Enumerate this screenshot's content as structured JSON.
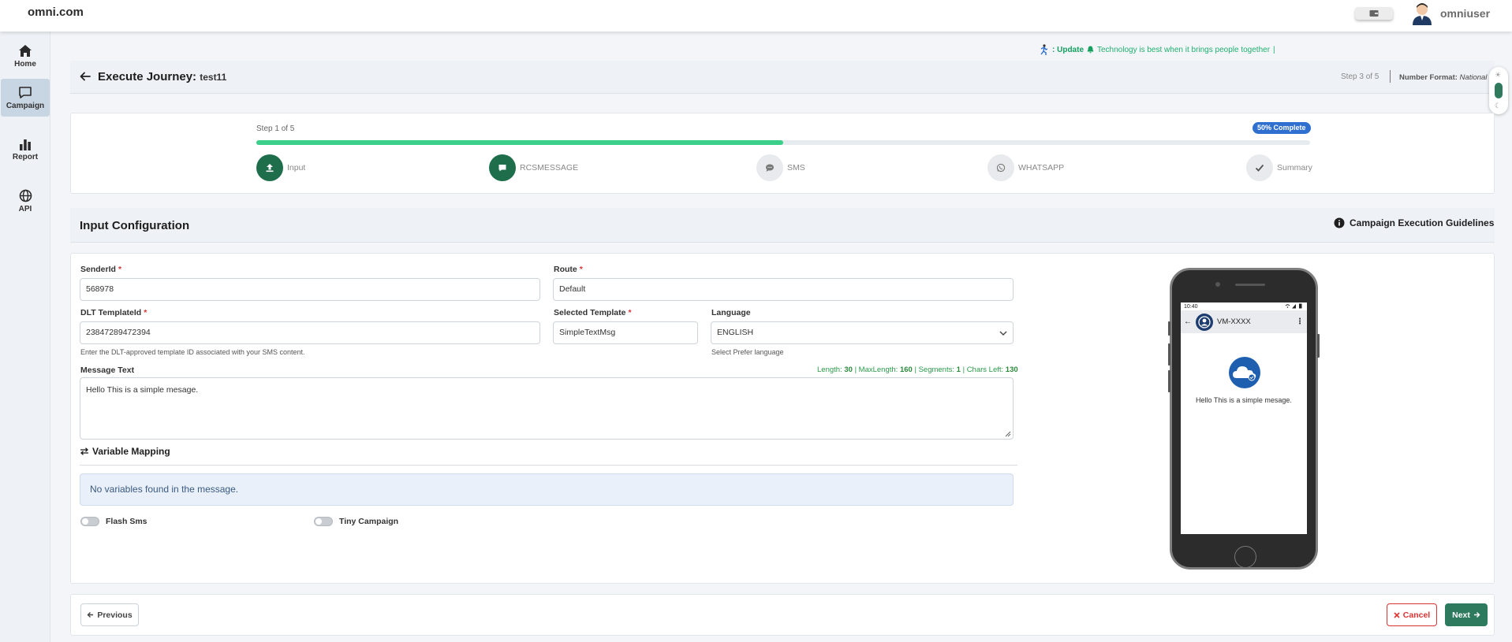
{
  "app": {
    "brand": "omni.com",
    "username": "omniuser"
  },
  "sidebar": {
    "items": [
      {
        "label": "Home",
        "icon": "home-icon"
      },
      {
        "label": "Campaign",
        "icon": "chat-icon",
        "active": true
      },
      {
        "label": "Report",
        "icon": "bar-chart-icon"
      },
      {
        "label": "API",
        "icon": "globe-icon"
      }
    ]
  },
  "announcement": {
    "prefix": ": Update",
    "text": "Technology is best when it brings people together",
    "suffix": "|"
  },
  "header": {
    "title": "Execute Journey:",
    "subtitle": "test11",
    "step_info": "Step 3 of 5",
    "number_format_label": "Number Format:",
    "number_format_value": "National"
  },
  "stepper": {
    "step_of": "Step 1 of 5",
    "percent_label": "50% Complete",
    "progress": 0.5,
    "steps": [
      {
        "label": "Input",
        "state": "done",
        "icon": "upload-icon"
      },
      {
        "label": "RCSMESSAGE",
        "state": "done",
        "icon": "message-icon"
      },
      {
        "label": "SMS",
        "state": "pending",
        "icon": "chat-bubble-icon"
      },
      {
        "label": "WHATSAPP",
        "state": "pending",
        "icon": "whatsapp-icon"
      },
      {
        "label": "Summary",
        "state": "pending",
        "icon": "check-icon"
      }
    ]
  },
  "section": {
    "title": "Input Configuration",
    "guidelines_label": "Campaign Execution Guidelines"
  },
  "form": {
    "sender_id": {
      "label": "SenderId",
      "value": "568978"
    },
    "route": {
      "label": "Route",
      "value": "Default"
    },
    "dlt_template": {
      "label": "DLT TemplateId",
      "value": "23847289472394",
      "hint": "Enter the DLT-approved template ID associated with your SMS content."
    },
    "selected_template": {
      "label": "Selected Template",
      "value": "SimpleTextMsg"
    },
    "language": {
      "label": "Language",
      "value": "ENGLISH",
      "hint": "Select Prefer language"
    },
    "message": {
      "label": "Message Text",
      "value": "Hello This is a simple mesage.",
      "length_label": "Length:",
      "length": "30",
      "maxlength_label": "MaxLength:",
      "maxlength": "160",
      "segments_label": "Segments:",
      "segments": "1",
      "chars_left_label": "Chars Left:",
      "chars_left": "130",
      "sep": "|"
    },
    "variable_mapping": {
      "title": "Variable Mapping",
      "empty_text": "No variables found in the message."
    },
    "flash_sms": {
      "label": "Flash Sms",
      "on": false
    },
    "tiny_campaign": {
      "label": "Tiny Campaign",
      "on": false
    }
  },
  "phone": {
    "time": "10:40",
    "sender": "VM-XXXX",
    "message": "Hello This is a simple mesage."
  },
  "footer": {
    "previous": "Previous",
    "cancel": "Cancel",
    "next": "Next"
  },
  "colors": {
    "accent": "#2d7a5f",
    "progress": "#3bcf8a",
    "badge": "#2f6fd0",
    "danger": "#dd3333"
  }
}
